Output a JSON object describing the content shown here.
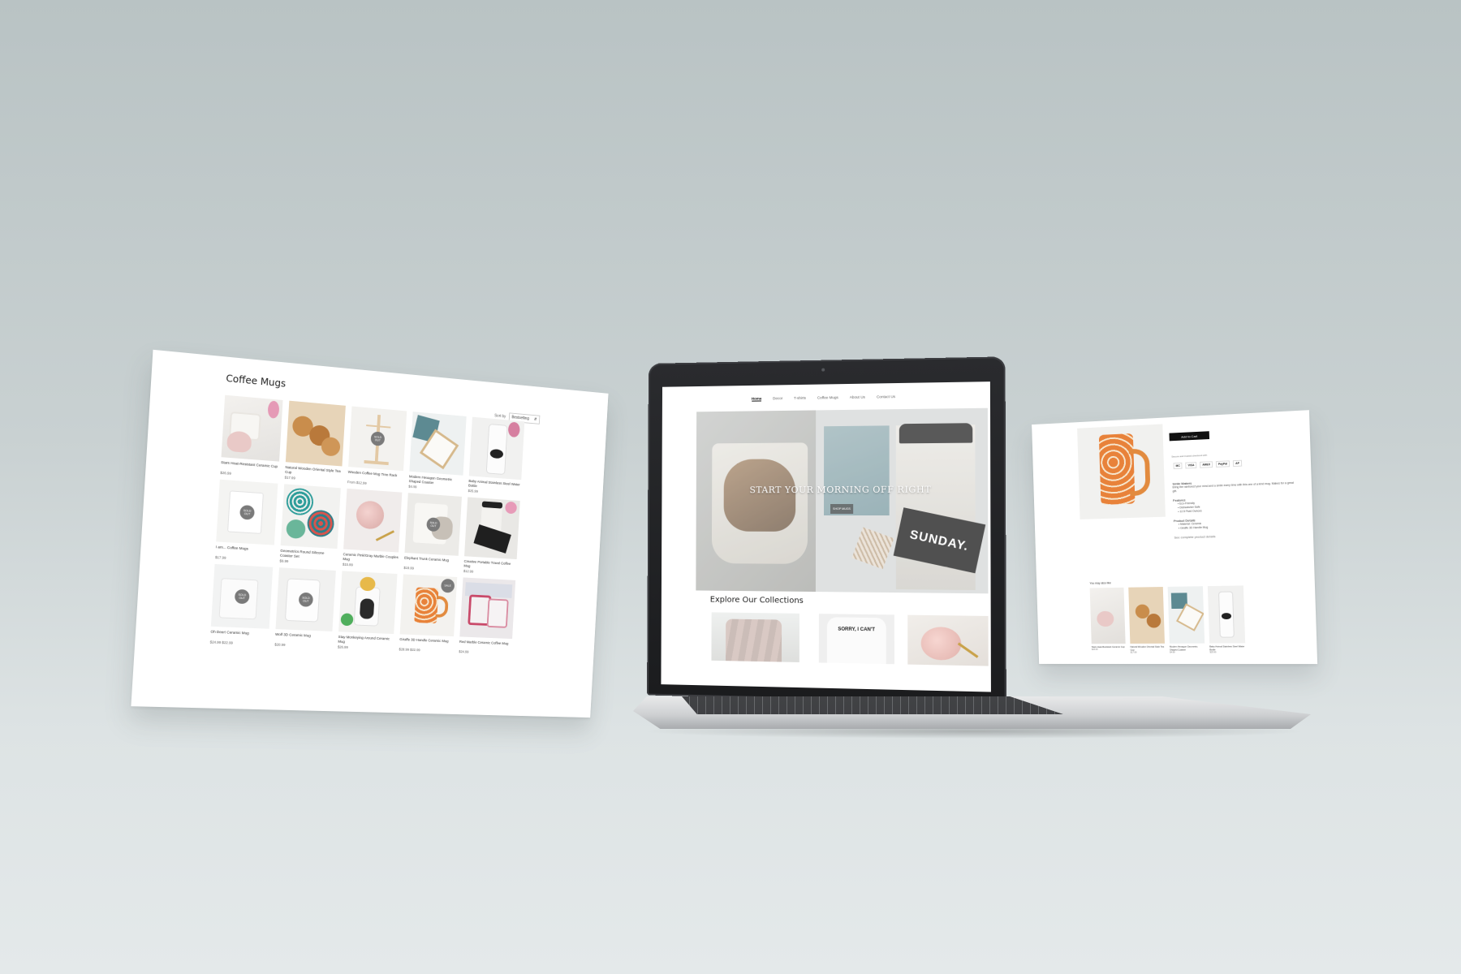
{
  "collection_page": {
    "title": "Coffee Mugs",
    "sort_label": "Sort by",
    "sort_value": "Bestselling",
    "products": [
      {
        "name": "Stars Heat-Resistant Ceramic Cup",
        "price": "$26.99",
        "badge": ""
      },
      {
        "name": "Natural Wooden Oriental Style Tea Cup",
        "price": "$17.99",
        "badge": ""
      },
      {
        "name": "Wooden Coffee Mug Tree Rack",
        "price": "From $12.99",
        "badge": "SOLD OUT"
      },
      {
        "name": "Modern Hexagon Geometric Shaped Coaster",
        "price": "$4.99",
        "badge": ""
      },
      {
        "name": "Baby Animal Stainless Steel Water Bottle",
        "price": "$25.99",
        "badge": ""
      },
      {
        "name": "I am... Coffee Mugs",
        "price": "$17.99",
        "badge": "SOLD OUT"
      },
      {
        "name": "Geometrics Round Silicone Coaster Set",
        "price": "$9.99",
        "badge": ""
      },
      {
        "name": "Ceramic Pink/Gray Marble Couples Mug",
        "price": "$15.99",
        "badge": ""
      },
      {
        "name": "Elephant Trunk Ceramic Mug",
        "price": "$19.99",
        "badge": "SOLD OUT"
      },
      {
        "name": "Creative Portable Travel Coffee Mug",
        "price": "$12.99",
        "badge": ""
      },
      {
        "name": "Oh Deer! Ceramic Mug",
        "price": "$24.99 $22.99",
        "badge": "SOLD OUT"
      },
      {
        "name": "Wolf 3D Ceramic Mug",
        "price": "$20.99",
        "badge": "SOLD OUT"
      },
      {
        "name": "Stay Monkeying Around Ceramic Mug",
        "price": "$26.99",
        "badge": ""
      },
      {
        "name": "Giraffe 3D Handle Ceramic Mug",
        "price": "$28.99 $22.99",
        "badge": "SALE"
      },
      {
        "name": "Red Marble Ceramic Coffee Mug",
        "price": "$24.99",
        "badge": ""
      }
    ]
  },
  "home_page": {
    "nav": [
      "Home",
      "Decor",
      "T-shirts",
      "Coffee Mugs",
      "About Us",
      "Contact Us"
    ],
    "hero_title": "START YOUR MORNING OFF RIGHT",
    "hero_button": "SHOP MUGS",
    "explore_title": "Explore Our Collections",
    "collection_shirt_text": "SORRY, I CAN'T",
    "hero_cup_text": "SUNDAY."
  },
  "product_page": {
    "buy_button": "Add to Cart",
    "secure_text": "Secure and trusted checkout with",
    "payments": [
      "MC",
      "VISA",
      "AMEX",
      "PayPal",
      "AP"
    ],
    "description_title": "Smile Makers",
    "description": "Bring the rainforest your mind and a smile every time with this one of a kind mug. Makes for a great gift.",
    "features_title": "Features",
    "features": [
      "Eco-Friendly",
      "Dishwasher Safe",
      "12.5 Fluid Ounces"
    ],
    "details_title": "Product Details",
    "details": [
      "Material: Ceramic",
      "Giraffe 3D Handle Mug"
    ],
    "link": "See complete product details",
    "also_title": "You may also like",
    "also": [
      {
        "name": "Stars Heat-Resistant Ceramic Cup",
        "price": "$26.99"
      },
      {
        "name": "Natural Wooden Oriental Style Tea Cup",
        "price": "$17.99"
      },
      {
        "name": "Modern Hexagon Geometric Shaped Coaster",
        "price": "$4.99"
      },
      {
        "name": "Baby Animal Stainless Steel Water Bottle",
        "price": "$25.99"
      }
    ]
  },
  "colors": {
    "background": "#c9d1d2",
    "accent": "#111111",
    "badge": "#7a7a7a"
  }
}
